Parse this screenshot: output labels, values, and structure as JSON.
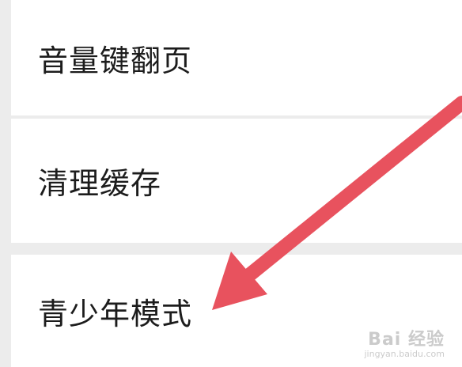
{
  "settings": {
    "items": [
      {
        "label": "音量键翻页"
      },
      {
        "label": "清理缓存"
      },
      {
        "label": "青少年模式"
      }
    ]
  },
  "annotation": {
    "arrow_color": "#e8525e",
    "arrow_target": "青少年模式"
  },
  "watermark": {
    "text": "Bai 经验",
    "url": "jingyan.baidu.com"
  },
  "colors": {
    "background": "#ececec",
    "card": "#ffffff",
    "text": "#1c1c1c"
  }
}
